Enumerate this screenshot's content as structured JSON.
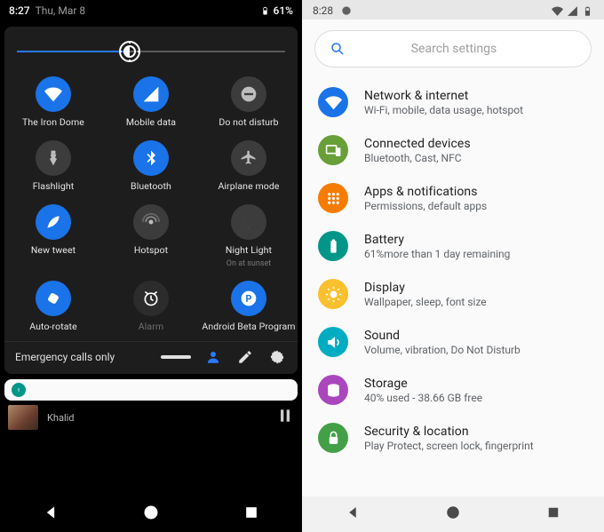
{
  "left": {
    "status": {
      "time": "8:27",
      "date": "Thu, Mar 8",
      "battery": "61%"
    },
    "brightness_pct": 42,
    "tiles": [
      {
        "id": "wifi",
        "state": "on",
        "icon": "wifi-icon",
        "label": "The Iron Dome"
      },
      {
        "id": "data",
        "state": "on",
        "icon": "cell-data-icon",
        "label": "Mobile data"
      },
      {
        "id": "dnd",
        "state": "off",
        "icon": "dnd-icon",
        "label": "Do not disturb"
      },
      {
        "id": "flash",
        "state": "off",
        "icon": "flashlight-icon",
        "label": "Flashlight"
      },
      {
        "id": "bt",
        "state": "on",
        "icon": "bluetooth-icon",
        "label": "Bluetooth"
      },
      {
        "id": "airplane",
        "state": "off",
        "icon": "airplane-icon",
        "label": "Airplane mode"
      },
      {
        "id": "tweet",
        "state": "on",
        "icon": "feather-icon",
        "label": "New tweet"
      },
      {
        "id": "hotspot",
        "state": "off",
        "icon": "hotspot-icon",
        "label": "Hotspot"
      },
      {
        "id": "night",
        "state": "off",
        "icon": "moon-icon",
        "label": "Night Light",
        "sub": "On at sunset"
      },
      {
        "id": "rotate",
        "state": "on",
        "icon": "rotate-icon",
        "label": "Auto-rotate"
      },
      {
        "id": "alarm",
        "state": "dim",
        "icon": "alarm-icon",
        "label": "Alarm"
      },
      {
        "id": "beta",
        "state": "on",
        "icon": "android-p-icon",
        "label": "Android Beta Program",
        "sub": ""
      }
    ],
    "footer_status": "Emergency calls only",
    "media_label": "Khalid"
  },
  "right": {
    "status_time": "8:28",
    "search_placeholder": "Search settings",
    "items": [
      {
        "id": "network",
        "color": "#1a73e8",
        "icon": "wifi-icon",
        "title": "Network & internet",
        "sub": "Wi-Fi, mobile, data usage, hotspot"
      },
      {
        "id": "devices",
        "color": "#689f38",
        "icon": "devices-icon",
        "title": "Connected devices",
        "sub": "Bluetooth, Cast, NFC"
      },
      {
        "id": "apps",
        "color": "#f57c00",
        "icon": "apps-icon",
        "title": "Apps & notifications",
        "sub": "Permissions, default apps"
      },
      {
        "id": "battery",
        "color": "#009688",
        "icon": "battery-icon",
        "title": "Battery",
        "sub": "61%more than 1 day remaining"
      },
      {
        "id": "display",
        "color": "#fbc02d",
        "icon": "display-icon",
        "title": "Display",
        "sub": "Wallpaper, sleep, font size"
      },
      {
        "id": "sound",
        "color": "#00acc1",
        "icon": "sound-icon",
        "title": "Sound",
        "sub": "Volume, vibration, Do Not Disturb"
      },
      {
        "id": "storage",
        "color": "#ab47bc",
        "icon": "storage-icon",
        "title": "Storage",
        "sub": "40% used - 38.66 GB free"
      },
      {
        "id": "security",
        "color": "#43a047",
        "icon": "lock-icon",
        "title": "Security & location",
        "sub": "Play Protect, screen lock, fingerprint"
      }
    ]
  }
}
